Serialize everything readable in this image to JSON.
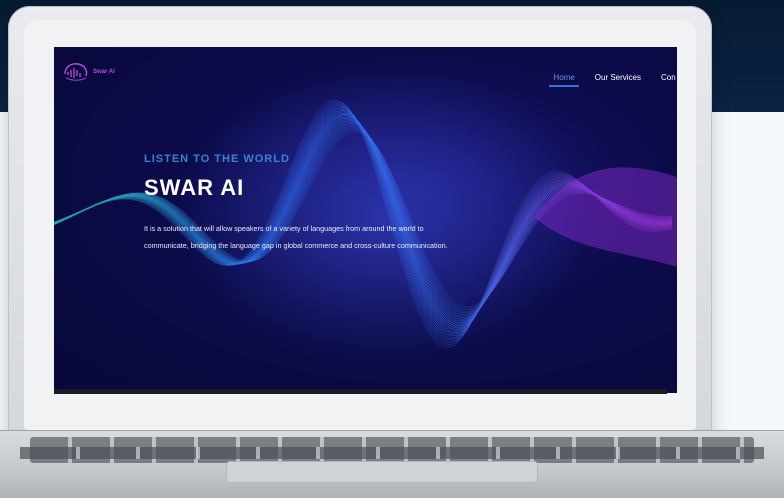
{
  "site": {
    "logo_text": "Swar AI",
    "nav": [
      {
        "label": "Home",
        "active": true
      },
      {
        "label": "Our Services",
        "active": false
      },
      {
        "label": "Con",
        "active": false
      }
    ],
    "hero": {
      "eyebrow": "LISTEN TO THE WORLD",
      "title": "SWAR AI",
      "description": "It is a solution that will allow speakers of a variety of languages from around the world to communicate, bridging the language gap in global commerce and cross-culture communication."
    }
  },
  "colors": {
    "page_top": "#061a33",
    "page_bottom": "#f2f7f9",
    "screen_bg": "#0c0b4a",
    "accent_blue": "#3a82d2",
    "logo_magenta": "#c04bd6",
    "wave_teal": "#22c9b7",
    "wave_blue": "#3d7bff",
    "wave_violet": "#b43bdc"
  },
  "icons": {
    "logo": "waveform-head-icon"
  }
}
